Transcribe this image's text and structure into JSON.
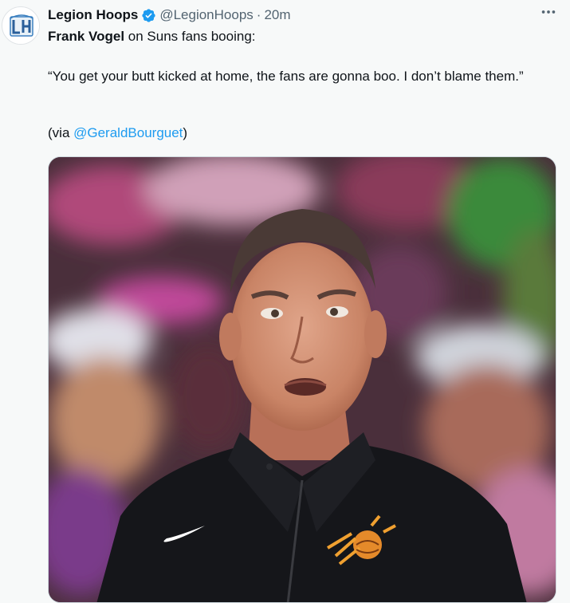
{
  "tweet": {
    "display_name": "Legion Hoops",
    "handle": "@LegionHoops",
    "separator": "·",
    "time": "20m",
    "avatar_icon": "legion-hoops-logo-icon",
    "verified_icon": "verified-badge-icon",
    "more_icon": "more-options-icon",
    "line1_bold": "Frank Vogel",
    "line1_rest": " on Suns fans booing:",
    "quote": "“You get your butt kicked at home, the fans are gonna boo. I don’t blame them.”",
    "via_prefix": "(via ",
    "via_mention": "@GeraldBourguet",
    "via_suffix": ")",
    "media": {
      "description_icon": "photo-coach-icon"
    }
  },
  "colors": {
    "link": "#1d9bf0",
    "text": "#0f1419",
    "secondary": "#536471",
    "verified": "#1d9bf0",
    "background": "#f7f9f9"
  }
}
